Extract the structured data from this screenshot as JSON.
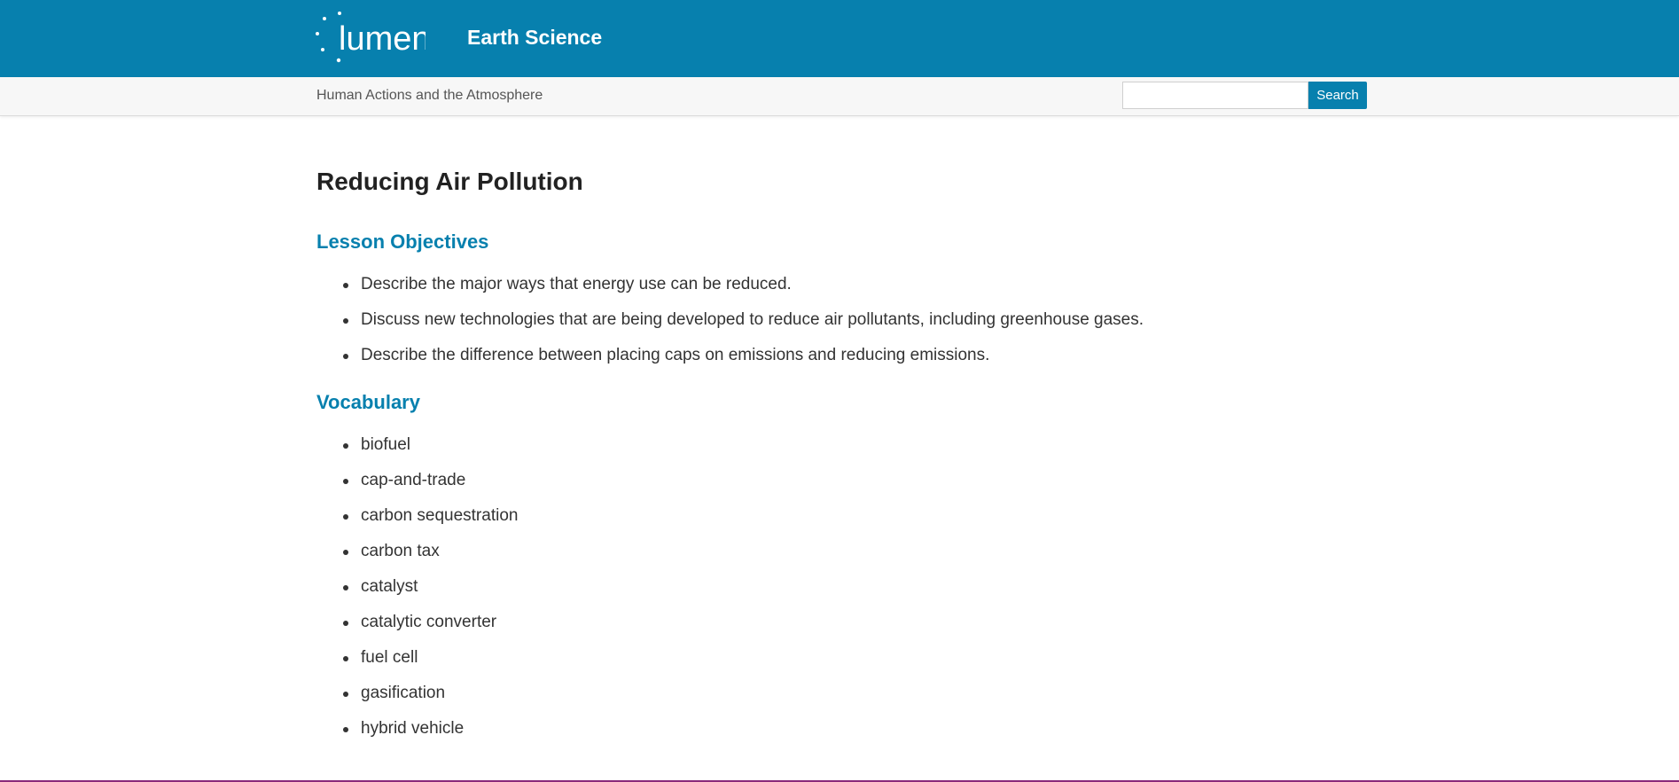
{
  "header": {
    "logo_text": "lumen",
    "course_title": "Earth Science",
    "background_color": "#0780ae"
  },
  "subheader": {
    "breadcrumb": "Human Actions and the Atmosphere",
    "search": {
      "value": "",
      "placeholder": "",
      "button_label": "Search"
    }
  },
  "main": {
    "title": "Reducing Air Pollution",
    "objectives": {
      "heading": "Lesson Objectives",
      "items": [
        "Describe the major ways that energy use can be reduced.",
        "Discuss new technologies that are being developed to reduce air pollutants, including greenhouse gases.",
        "Describe the difference between placing caps on emissions and reducing emissions."
      ]
    },
    "vocabulary": {
      "heading": "Vocabulary",
      "items": [
        "biofuel",
        "cap-and-trade",
        "carbon sequestration",
        "carbon tax",
        "catalyst",
        "catalytic converter",
        "fuel cell",
        "gasification",
        "hybrid vehicle"
      ]
    }
  },
  "colors": {
    "accent": "#0780ae",
    "text": "#333333",
    "bottom_border": "#8a2a7a"
  }
}
